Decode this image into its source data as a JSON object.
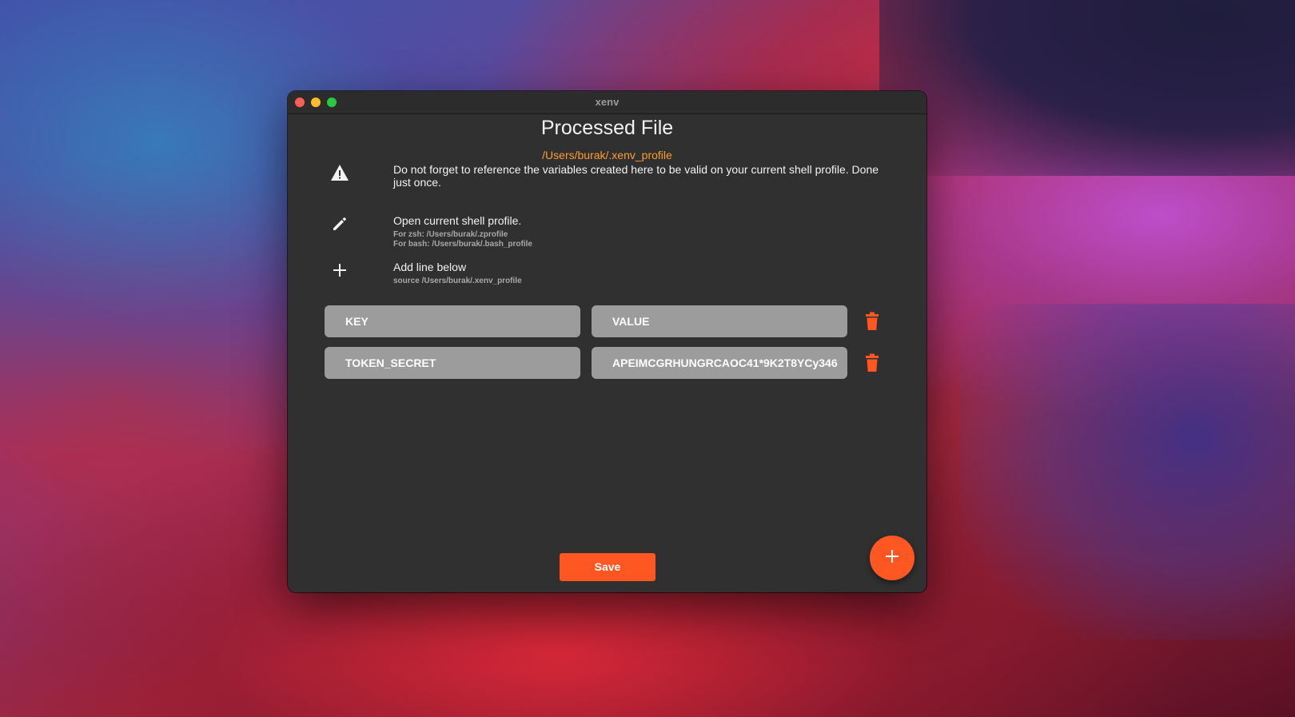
{
  "window": {
    "title": "xenv"
  },
  "main": {
    "title": "Processed File",
    "file_path": "/Users/burak/.xenv_profile"
  },
  "instructions": {
    "warning": {
      "icon": "warning-icon",
      "text": "Do not forget to reference the variables created here to be valid on your current shell profile. Done just once."
    },
    "open_profile": {
      "icon": "pencil-icon",
      "text": "Open current shell profile.",
      "zsh": "For zsh: /Users/burak/.zprofile",
      "bash": "For bash: /Users/burak/.bash_profile"
    },
    "add_line": {
      "icon": "plus-icon",
      "text": "Add line below",
      "command": "source /Users/burak/.xenv_profile"
    }
  },
  "variables": [
    {
      "key": "KEY",
      "value": "VALUE"
    },
    {
      "key": "TOKEN_SECRET",
      "value": "APEIMCGRHUNGRCAOC41*9K2T8YCy346"
    }
  ],
  "actions": {
    "save_label": "Save",
    "add_icon": "plus-icon",
    "delete_icon": "trash-icon"
  },
  "colors": {
    "accent": "#ff5722",
    "path": "#ff9d2a",
    "background": "#303030",
    "field": "#9c9c9c"
  }
}
